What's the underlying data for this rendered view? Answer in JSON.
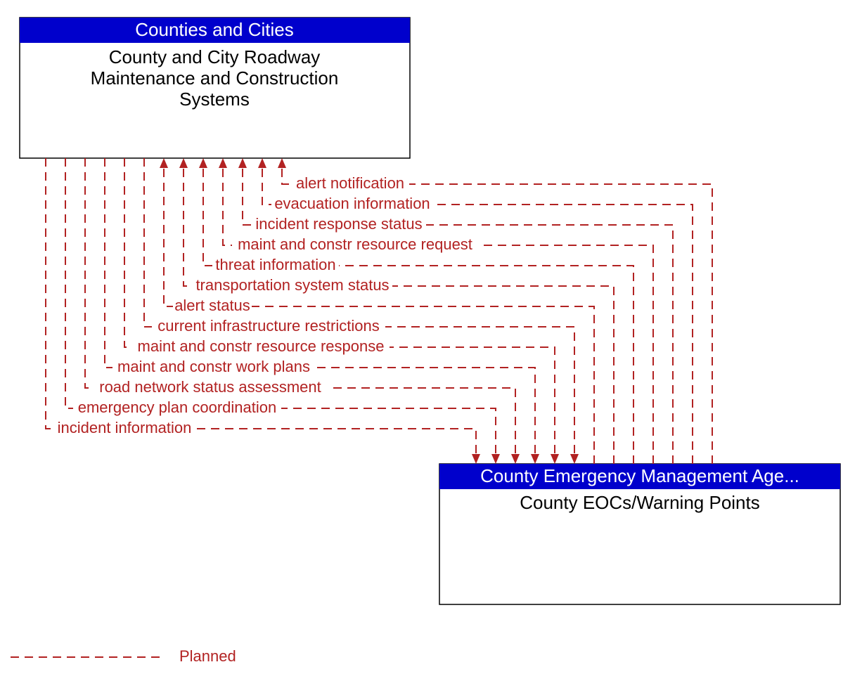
{
  "topNode": {
    "header": "Counties and Cities",
    "body_line1": "County and City Roadway",
    "body_line2": "Maintenance and Construction",
    "body_line3": "Systems"
  },
  "bottomNode": {
    "header": "County Emergency Management Age...",
    "body_line1": "County EOCs/Warning Points"
  },
  "flows": {
    "f0": "alert notification",
    "f1": "evacuation information",
    "f2": "incident response status",
    "f3": "maint and constr resource request",
    "f4": "threat information",
    "f5": "transportation system status",
    "f6": "alert status",
    "f7": "current infrastructure restrictions",
    "f8": "maint and constr resource response",
    "f9": "maint and constr work plans",
    "f10": "road network status assessment",
    "f11": "emergency plan coordination",
    "f12": "incident information"
  },
  "legend": {
    "planned": "Planned"
  }
}
